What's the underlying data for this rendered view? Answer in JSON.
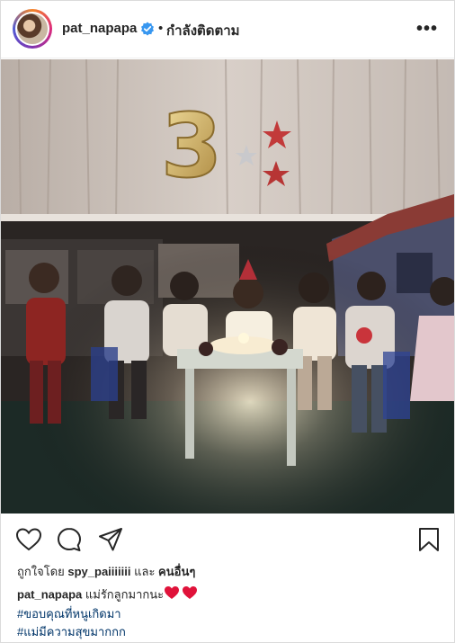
{
  "header": {
    "username": "pat_napapa",
    "separator": "•",
    "follow_status": "กำลังติดตาม",
    "more_label": "•••"
  },
  "photo": {
    "balloon_number": "3"
  },
  "actions": {
    "icons": [
      "heart-icon",
      "comment-icon",
      "share-icon",
      "bookmark-icon"
    ]
  },
  "likes": {
    "prefix": "ถูกใจโดย",
    "user": "spy_paiiiiiii",
    "conjunction": "และ",
    "others": "คนอื่นๆ"
  },
  "caption": {
    "username": "pat_napapa",
    "text": "แม่รักลูกมากนะ",
    "emoji": "❤️❤️",
    "hashtags": [
      "#ขอบคุณที่หนูเกิดมา",
      "#แม่มีความสุขมากกก"
    ]
  },
  "colors": {
    "verified": "#3897f0",
    "hashtag": "#003569",
    "heart_emoji": "#e0123a"
  }
}
